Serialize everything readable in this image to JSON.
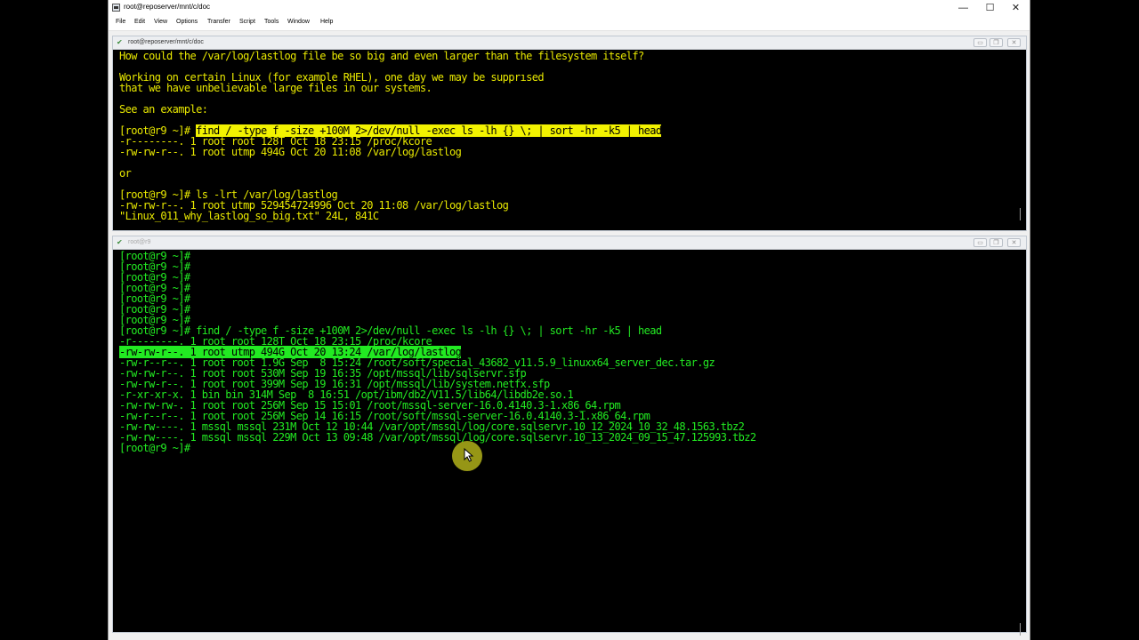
{
  "window": {
    "title": "root@reposerver/mnt/c/doc",
    "minimize_label": "—",
    "maximize_label": "☐",
    "close_label": "✕"
  },
  "menu": [
    "File",
    "Edit",
    "View",
    "Options",
    "Transfer",
    "Script",
    "Tools",
    "Window",
    "Help"
  ],
  "top_pane": {
    "title": "root@reposerver/mnt/c/doc",
    "lines": [
      "How could the /var/log/lastlog file be so big and even larger than the filesystem itself?",
      "",
      "Working on certain Linux (for example RHEL), one day we may be supprısed",
      "that we have unbelievable large files in our systems.",
      "",
      "See an example:",
      "",
      "[root@r9 ~]# ",
      "-r--------. 1 root root 128T Oct 18 23:15 /proc/kcore",
      "-rw-rw-r--. 1 root utmp 494G Oct 20 11:08 /var/log/lastlog",
      "",
      "or",
      "",
      "[root@r9 ~]# ls -lrt /var/log/lastlog",
      "-rw-rw-r--. 1 root utmp 529454724996 Oct 20 11:08 /var/log/lastlog",
      "\"Linux_011_why_lastlog_so_big.txt\" 24L, 841C"
    ],
    "highlighted_command": "find / -type f -size +100M 2>/dev/null -exec ls -lh {} \\; | sort -hr -k5 | head"
  },
  "bottom_pane": {
    "title": "root@r9",
    "lines": [
      "[root@r9 ~]#",
      "[root@r9 ~]#",
      "[root@r9 ~]#",
      "[root@r9 ~]#",
      "[root@r9 ~]#",
      "[root@r9 ~]#",
      "[root@r9 ~]#",
      "[root@r9 ~]# find / -type f -size +100M 2>/dev/null -exec ls -lh {} \\; | sort -hr -k5 | head",
      "-r--------. 1 root root 128T Oct 18 23:15 /proc/kcore",
      "-rw-rw-r--. 1 root utmp 494G Oct 20 13:24 /var/log/lastlog",
      "-rw-r--r--. 1 root root 1.9G Sep  8 15:24 /root/soft/special_43682_v11.5.9_linuxx64_server_dec.tar.gz",
      "-rw-rw-r--. 1 root root 530M Sep 19 16:35 /opt/mssql/lib/sqlservr.sfp",
      "-rw-rw-r--. 1 root root 399M Sep 19 16:31 /opt/mssql/lib/system.netfx.sfp",
      "-r-xr-xr-x. 1 bin bin 314M Sep  8 16:51 /opt/ibm/db2/V11.5/lib64/libdb2e.so.1",
      "-rw-rw-rw-. 1 root root 256M Sep 15 15:01 /root/mssql-server-16.0.4140.3-1.x86_64.rpm",
      "-rw-r--r--. 1 root root 256M Sep 14 16:15 /root/soft/mssql-server-16.0.4140.3-1.x86_64.rpm",
      "-rw-rw----. 1 mssql mssql 231M Oct 12 10:44 /var/opt/mssql/log/core.sqlservr.10_12_2024_10_32_48.1563.tbz2",
      "-rw-rw----. 1 mssql mssql 229M Oct 13 09:48 /var/opt/mssql/log/core.sqlservr.10_13_2024_09_15_47.125993.tbz2",
      "[root@r9 ~]#"
    ],
    "highlighted_line_index": 9
  },
  "colors": {
    "top_text": "#e8e800",
    "bottom_text": "#22ea22",
    "terminal_bg": "#000000"
  }
}
